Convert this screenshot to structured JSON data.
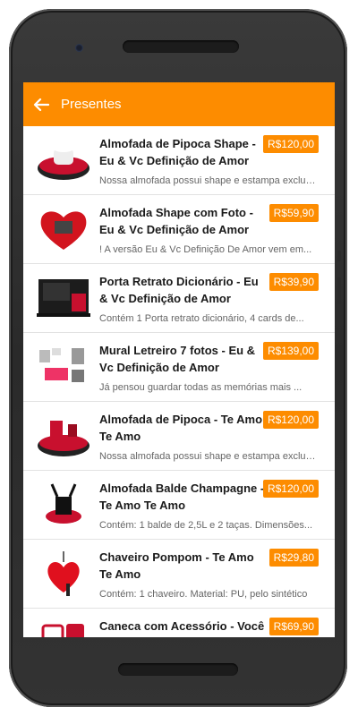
{
  "appbar": {
    "title": "Presentes",
    "back_icon": "arrow-left-icon"
  },
  "colors": {
    "accent": "#fd8c00"
  },
  "items": [
    {
      "name": "Almofada de Pipoca Shape - Eu & Vc Definição de Amor",
      "price": "R$120,00",
      "desc": "Nossa almofada possui shape e estampa exclusiva"
    },
    {
      "name": "Almofada Shape com Foto - Eu & Vc Definição de Amor",
      "price": "R$59,90",
      "desc": "! A versão Eu & Vc Definição De Amor vem em..."
    },
    {
      "name": "Porta Retrato Dicionário - Eu & Vc Definição de Amor",
      "price": "R$39,90",
      "desc": "Contém 1 Porta retrato dicionário, 4 cards de..."
    },
    {
      "name": "Mural Letreiro 7 fotos - Eu & Vc Definição de Amor",
      "price": "R$139,00",
      "desc": "Já pensou guardar todas as memórias mais ..."
    },
    {
      "name": "Almofada de Pipoca - Te Amo Te Amo",
      "price": "R$120,00",
      "desc": "Nossa almofada possui shape e estampa exclusiva"
    },
    {
      "name": "Almofada Balde Champagne - Te Amo Te Amo",
      "price": "R$120,00",
      "desc": "Contém: 1 balde de 2,5L e 2 taças. Dimensões..."
    },
    {
      "name": "Chaveiro Pompom - Te Amo Te Amo",
      "price": "R$29,80",
      "desc": "Contém: 1 chaveiro. Material: PU, pelo sintético"
    },
    {
      "name": "Caneca com Acessório - Você é",
      "price": "R$69,90",
      "desc": ""
    }
  ]
}
